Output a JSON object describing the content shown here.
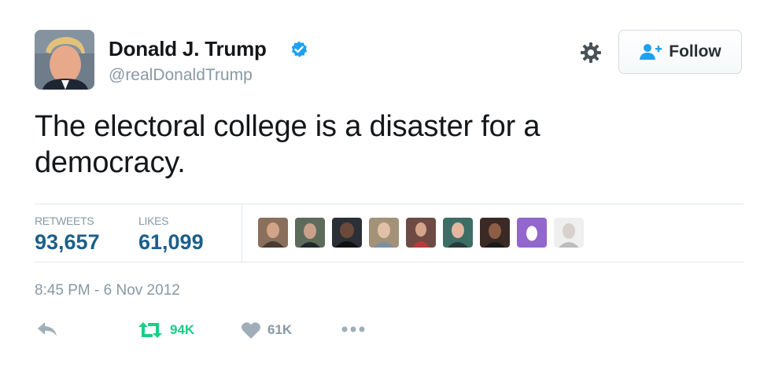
{
  "user": {
    "name": "Donald J. Trump",
    "handle": "@realDonaldTrump",
    "verified": true
  },
  "follow_button": {
    "label": "Follow"
  },
  "tweet": {
    "line1": "The electoral college is a disaster for a",
    "line2": "democracy."
  },
  "stats": {
    "retweets_label": "RETWEETS",
    "retweets_value": "93,657",
    "likes_label": "LIKES",
    "likes_value": "61,099"
  },
  "likers": [
    {
      "icon": "liker-avatar",
      "color": "#8a6f5c"
    },
    {
      "icon": "liker-avatar",
      "color": "#5d6b5a"
    },
    {
      "icon": "liker-avatar",
      "color": "#2b2f36"
    },
    {
      "icon": "liker-avatar",
      "color": "#a39277"
    },
    {
      "icon": "liker-avatar",
      "color": "#6e4a44"
    },
    {
      "icon": "liker-avatar",
      "color": "#3c6e66"
    },
    {
      "icon": "liker-avatar",
      "color": "#3a2a26"
    },
    {
      "icon": "egg-avatar",
      "color": "#9266cc"
    },
    {
      "icon": "liker-avatar",
      "color": "#d8d8d8"
    }
  ],
  "timestamp": "8:45 PM - 6 Nov 2012",
  "actions": {
    "reply_icon": "reply-icon",
    "retweet_count": "94K",
    "like_count": "61K",
    "more_icon": "more-icon"
  },
  "colors": {
    "link_blue": "#1c5f8a",
    "retweet_green": "#19cf86",
    "muted_gray": "#8899a6",
    "verified_blue": "#1da1f2"
  }
}
